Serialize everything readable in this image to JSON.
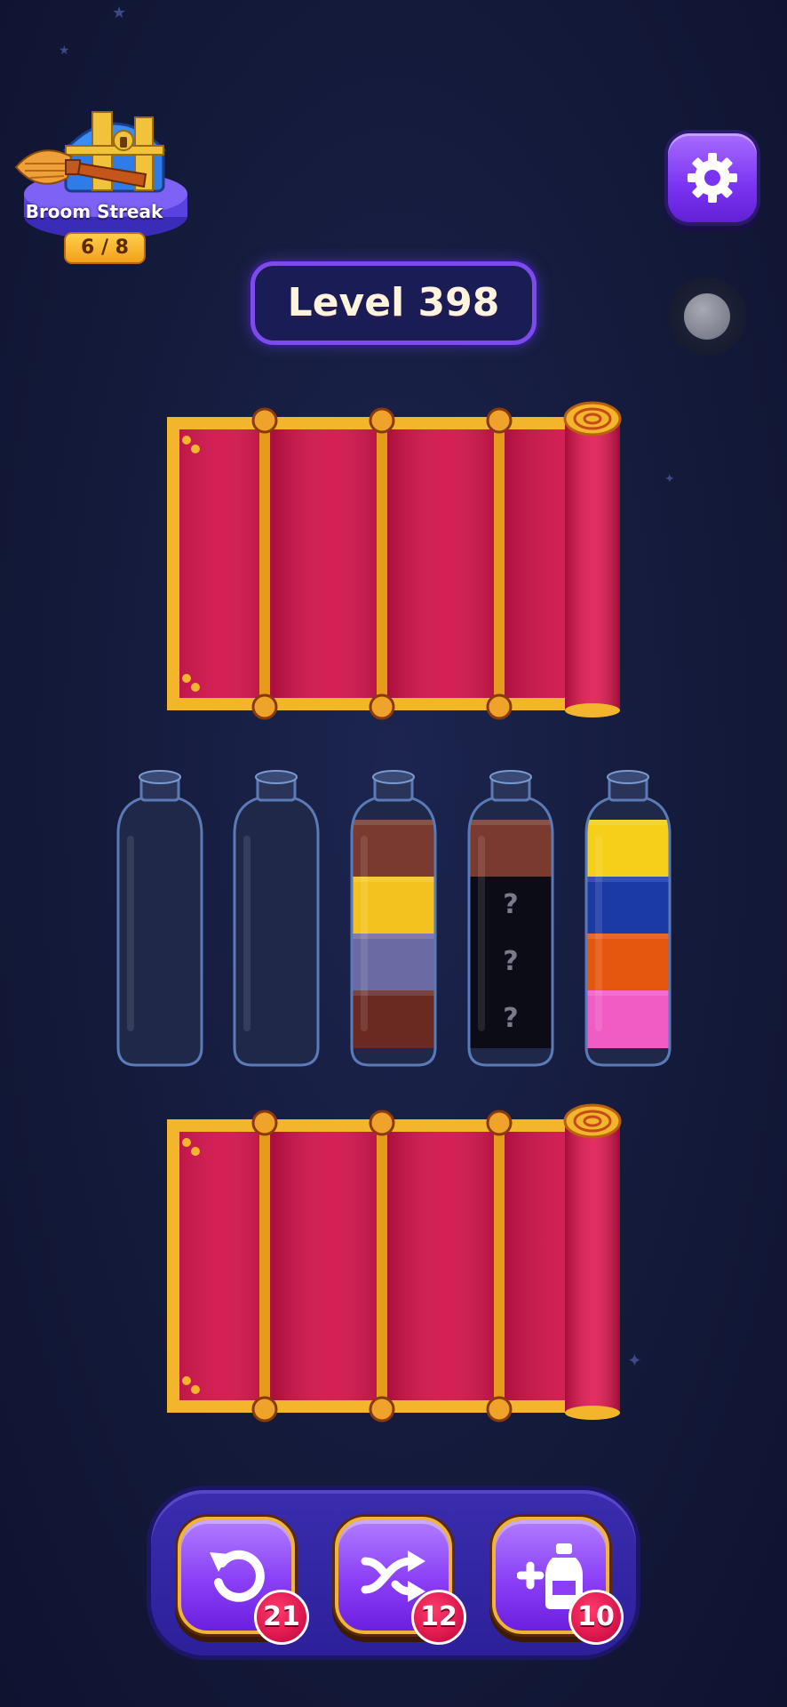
{
  "streak": {
    "label": "Broom Streak",
    "count": "6 / 8"
  },
  "level": {
    "label": "Level 398"
  },
  "settings": {
    "icon": "gear-icon"
  },
  "colors": {
    "accent_purple": "#8a3ff6",
    "curtain_red": "#d9134c",
    "curtain_gold": "#f2b52c",
    "badge_red": "#d6124a"
  },
  "bottles": [
    {
      "segments": [],
      "hidden": false
    },
    {
      "segments": [],
      "hidden": false
    },
    {
      "segments": [
        "#7a3a30",
        "#f4c21e",
        "#6b6aa2",
        "#6a2a22"
      ],
      "hidden": false
    },
    {
      "segments": [
        "#7a3a30",
        "hidden",
        "hidden",
        "hidden"
      ],
      "hidden": true,
      "unknown_mark": "?"
    },
    {
      "segments": [
        "#f6cf1a",
        "#1c3aa6",
        "#e5560e",
        "#f05cc4"
      ],
      "hidden": false
    }
  ],
  "toolbar": {
    "undo": {
      "icon": "undo-icon",
      "count": "21"
    },
    "shuffle": {
      "icon": "shuffle-icon",
      "count": "12"
    },
    "add_bottle": {
      "icon": "add-bottle-icon",
      "count": "10"
    }
  }
}
